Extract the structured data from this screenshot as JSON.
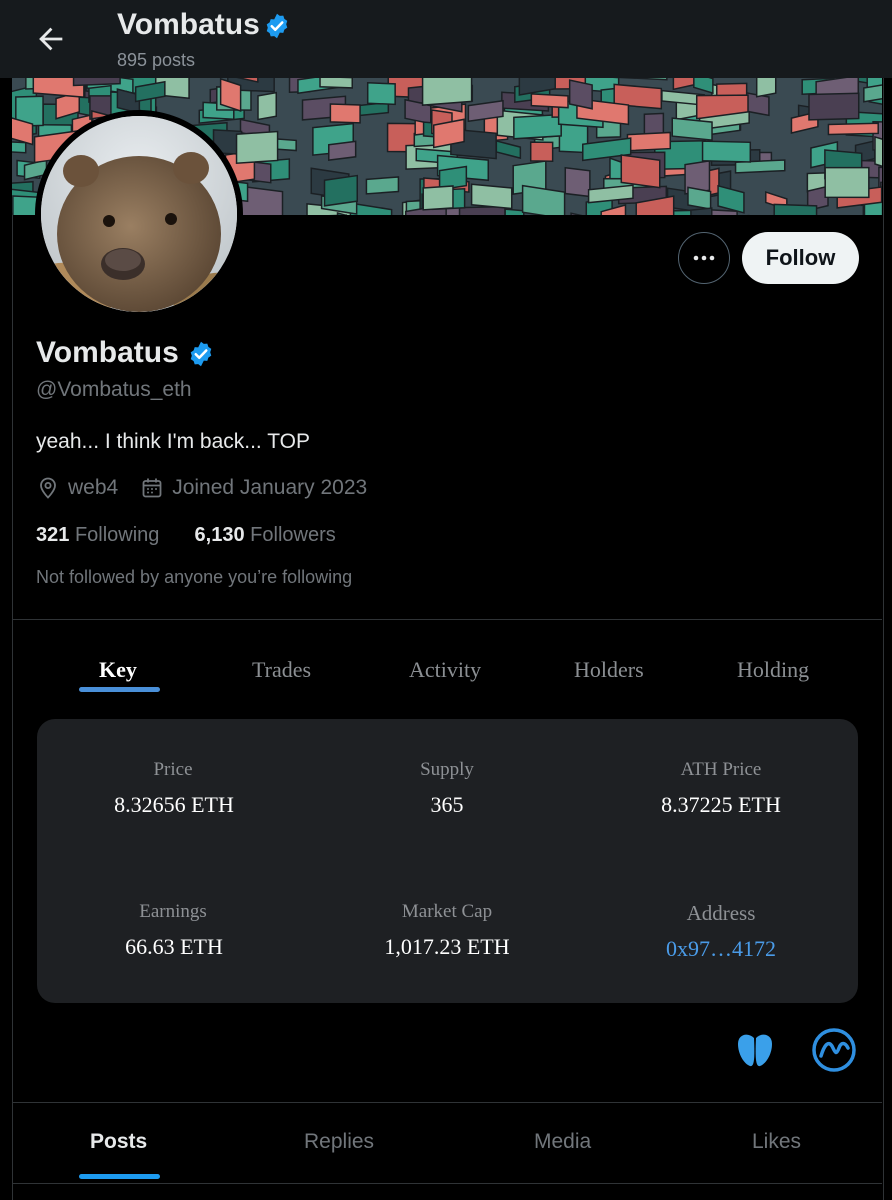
{
  "header": {
    "title": "Vombatus",
    "posts_count": "895 posts"
  },
  "profile": {
    "display_name": "Vombatus",
    "handle": "@Vombatus_eth",
    "bio": "yeah... I think I'm back...  TOP",
    "location": "web4",
    "joined": "Joined January 2023",
    "following_count": "321",
    "following_label": "Following",
    "followers_count": "6,130",
    "followers_label": "Followers",
    "mutuals_note": "Not followed by anyone you’re following",
    "follow_label": "Follow"
  },
  "plugin": {
    "tabs": [
      "Key",
      "Trades",
      "Activity",
      "Holders",
      "Holding"
    ],
    "active_tab": "Key",
    "stats": [
      {
        "label": "Price",
        "value": "8.32656 ETH"
      },
      {
        "label": "Supply",
        "value": "365"
      },
      {
        "label": "ATH Price",
        "value": "8.37225 ETH"
      },
      {
        "label": "Earnings",
        "value": "66.63 ETH"
      },
      {
        "label": "Market Cap",
        "value": "1,017.23 ETH"
      },
      {
        "label": "Address",
        "value": "0x97…4172"
      }
    ]
  },
  "profile_tabs": [
    "Posts",
    "Replies",
    "Media",
    "Likes"
  ],
  "colors": {
    "accent": "#1d9bf0",
    "verified": "#1d9bf0",
    "plugin_accent": "#4a90d9"
  }
}
